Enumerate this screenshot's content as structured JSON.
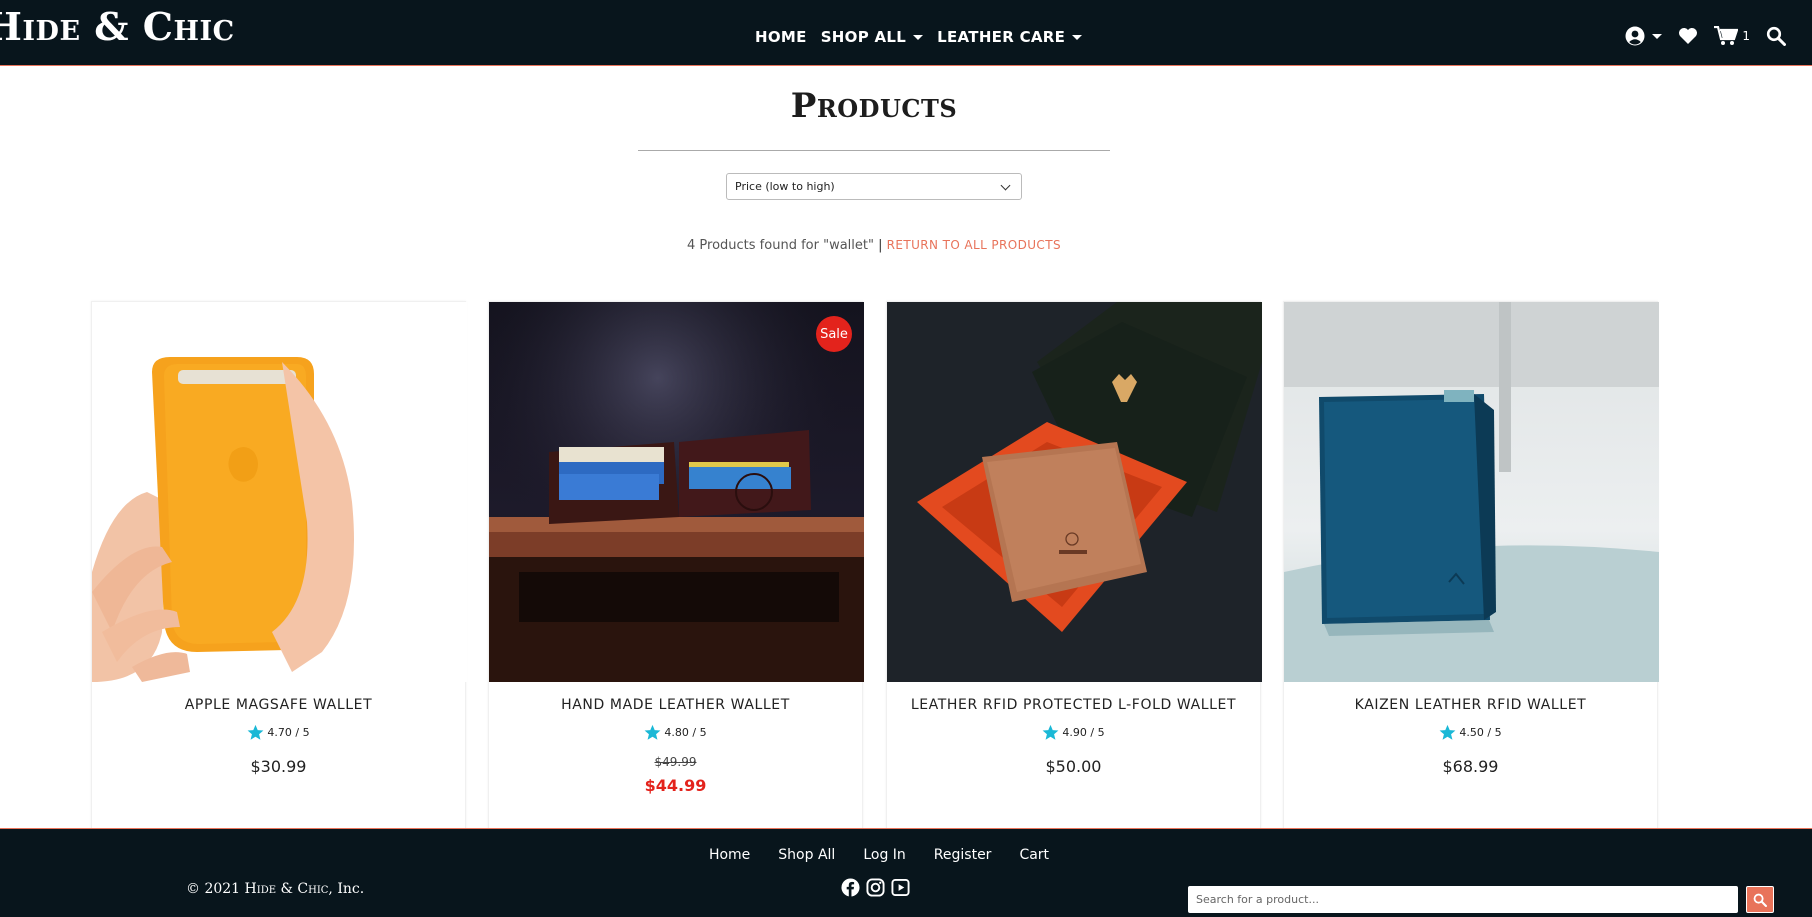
{
  "brand": {
    "name": "Hide & Chic"
  },
  "nav": {
    "links": [
      {
        "label": "HOME"
      },
      {
        "label": "SHOP ALL"
      },
      {
        "label": "LEATHER CARE"
      }
    ],
    "cart_count": "1",
    "icons": [
      "user-icon",
      "heart-icon",
      "cart-icon",
      "search-icon"
    ]
  },
  "main": {
    "title": "Products",
    "sort": {
      "selected": "Price (low to high)"
    },
    "results": {
      "text": "4 Products found for \"wallet\"",
      "separator": "|",
      "return_link": "RETURN TO ALL PRODUCTS"
    }
  },
  "products": [
    {
      "name": "APPLE MAGSAFE WALLET",
      "rating": "4.70 / 5",
      "price": "$30.99"
    },
    {
      "name": "HAND MADE LEATHER WALLET",
      "rating": "4.80 / 5",
      "old_price": "$49.99",
      "price": "$44.99",
      "badge": "Sale"
    },
    {
      "name": "LEATHER RFID PROTECTED L-FOLD WALLET",
      "rating": "4.90 / 5",
      "price": "$50.00"
    },
    {
      "name": "KAIZEN LEATHER RFID WALLET",
      "rating": "4.50 / 5",
      "price": "$68.99"
    }
  ],
  "footer": {
    "links": [
      "Home",
      "Shop All",
      "Log In",
      "Register",
      "Cart"
    ],
    "copyright_prefix": "© 2021",
    "copyright_brand": "Hide & Chic",
    "copyright_suffix": ", Inc.",
    "social": [
      "facebook-icon",
      "instagram-icon",
      "youtube-icon"
    ],
    "search_placeholder": "Search for a product..."
  },
  "colors": {
    "navbar_bg": "#08151c",
    "accent": "#e8735a",
    "sale_red": "#e3231c",
    "star": "#1ab8d6"
  }
}
